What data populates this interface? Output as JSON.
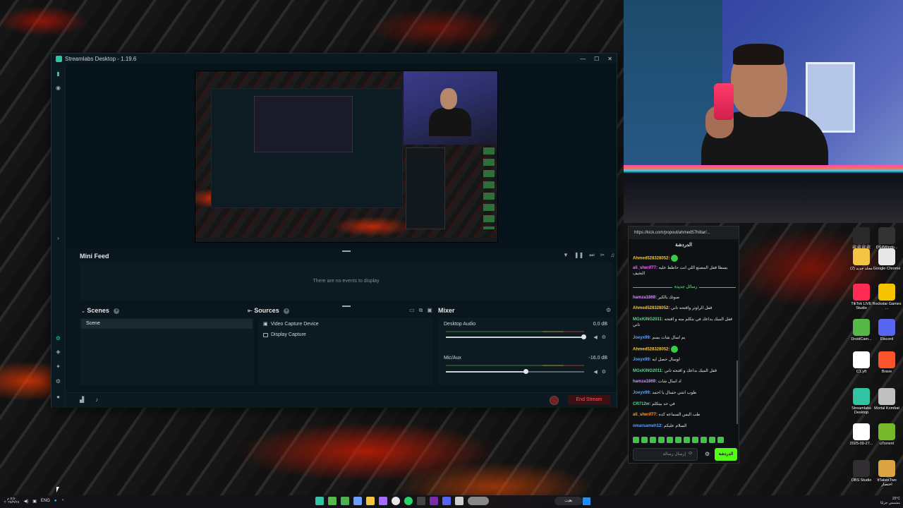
{
  "window": {
    "title": "Streamlabs Desktop - 1.19.6",
    "minimize": "—",
    "maximize": "☐",
    "close": "✕"
  },
  "minifeed": {
    "title": "Mini Feed",
    "empty_text": "There are no events to display"
  },
  "scenes": {
    "title": "Scenes",
    "items": [
      "Scene"
    ]
  },
  "sources": {
    "title": "Sources",
    "items": [
      "Video Capture Device",
      "Display Capture"
    ]
  },
  "mixer": {
    "title": "Mixer",
    "channels": [
      {
        "name": "Desktop Audio",
        "db": "0.0 dB",
        "level": 1.0
      },
      {
        "name": "Mic/Aux",
        "db": "-16.0 dB",
        "level": 0.58
      }
    ]
  },
  "controls": {
    "end_stream": "End Stream"
  },
  "chat": {
    "url": "https://kick.com/popout/ahmed57hitlar/...",
    "title": "الدردشة",
    "new_messages": "رسائل جديدة",
    "messages": [
      {
        "user": "Ahmed528328052:",
        "text": "",
        "cls": "u1"
      },
      {
        "user": "ali_sherif77:",
        "text": "يسطا قفل المصنع اللي انت حاطط عليه التخيف",
        "cls": "u2"
      },
      {
        "user": "hamza1869:",
        "text": "صوتك بالكير",
        "cls": "u7"
      },
      {
        "user": "Ahmed528328052:",
        "text": "قفل الراوتر واقتحه تاني",
        "cls": "u1"
      },
      {
        "user": "MGxKING2011:",
        "text": "قفل الميك بداعك في بتكلم منه و اقتحه تاني",
        "cls": "u4"
      },
      {
        "user": "Joeyx99:",
        "text": "يم اسال شات يسم",
        "cls": "u3"
      },
      {
        "user": "Ahmed528328052:",
        "text": "",
        "cls": "u1"
      },
      {
        "user": "Joeyx99:",
        "text": "لوسال حصل ايه",
        "cls": "u3"
      },
      {
        "user": "MGxKING2011:",
        "text": "قفل الميك بداعك و اقتحه تاني",
        "cls": "u4"
      },
      {
        "user": "hamza1869:",
        "text": "اد اسال شات",
        "cls": "u7"
      },
      {
        "user": "Joeyx99:",
        "text": "طوب انتني حسال يا احمد",
        "cls": "u3"
      },
      {
        "user": "CR712w:",
        "text": "في حد بيتكلم",
        "cls": "u4"
      },
      {
        "user": "ali_sherif77:",
        "text": "طب اليس السماعه كده",
        "cls": "u6"
      },
      {
        "user": "omarsameh12:",
        "text": "السلام عليكم",
        "cls": "u3"
      }
    ],
    "input_placeholder": "إرسال رسالة",
    "send_label": "الدردشة"
  },
  "desktop_icons": [
    {
      "label": "ﷺﷺﷺﷺ",
      "color": "#2a2a2a"
    },
    {
      "label": "DS4Windo...",
      "color": "#333"
    },
    {
      "label": "مجلد جديد (2)",
      "color": "#f4c542"
    },
    {
      "label": "Google Chrome",
      "color": "#e8e8e8"
    },
    {
      "label": "TikTok LIVE Studio",
      "color": "#fe2c55"
    },
    {
      "label": "Rockstar Games ...",
      "color": "#f5c400"
    },
    {
      "label": "DroidCam...",
      "color": "#55b94a"
    },
    {
      "label": "Discord",
      "color": "#5865f2"
    },
    {
      "label": "C1.yft",
      "color": "#ffffff"
    },
    {
      "label": "Brave",
      "color": "#fb542b"
    },
    {
      "label": "Streamlabs Desktop",
      "color": "#31c3a2"
    },
    {
      "label": "Mortal Kombat",
      "color": "#c0c0c0"
    },
    {
      "label": "2025-09-27...",
      "color": "#ffffff"
    },
    {
      "label": "uTorrent",
      "color": "#76b82a"
    },
    {
      "label": "OBS Studio",
      "color": "#302e31"
    },
    {
      "label": "ItTakesTwo اختصار",
      "color": "#d9a441"
    }
  ],
  "taskbar": {
    "search": "بحث",
    "lang": "ENG",
    "weather": "25°C",
    "weather_desc": "مشمس جزئيًا",
    "time": "٥:٥٠ م",
    "date": "٢٠٢٥/٩/٢٨"
  }
}
